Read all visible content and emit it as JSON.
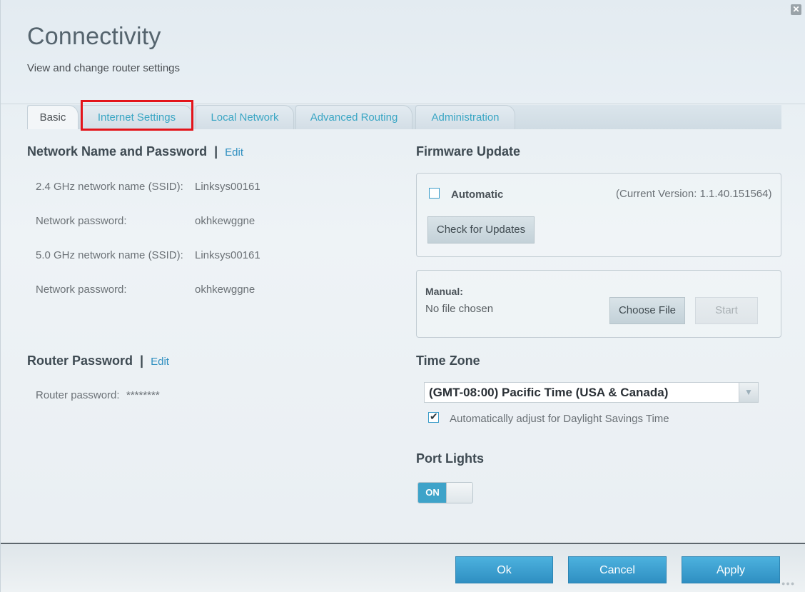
{
  "header": {
    "title": "Connectivity",
    "subtitle": "View and change router settings",
    "close_glyph": "✕"
  },
  "tabs": [
    {
      "label": "Basic",
      "active": true
    },
    {
      "label": "Internet Settings",
      "active": false
    },
    {
      "label": "Local Network",
      "active": false
    },
    {
      "label": "Advanced Routing",
      "active": false
    },
    {
      "label": "Administration",
      "active": false
    }
  ],
  "network": {
    "title": "Network Name and Password",
    "separator": "|",
    "edit_label": "Edit",
    "rows": [
      {
        "label": "2.4 GHz network name (SSID):",
        "value": "Linksys00161"
      },
      {
        "label": "Network password:",
        "value": "okhkewggne"
      },
      {
        "label": "5.0 GHz network name (SSID):",
        "value": "Linksys00161"
      },
      {
        "label": "Network password:",
        "value": "okhkewggne"
      }
    ]
  },
  "router_password": {
    "title": "Router Password",
    "separator": "|",
    "edit_label": "Edit",
    "label": "Router password:",
    "value": "********"
  },
  "firmware": {
    "title": "Firmware Update",
    "automatic_label": "Automatic",
    "automatic_checked": false,
    "current_version": "(Current Version: 1.1.40.151564)",
    "check_button": "Check for Updates",
    "manual_label": "Manual:",
    "file_status": "No file chosen",
    "choose_file_button": "Choose File",
    "start_button": "Start"
  },
  "time_zone": {
    "title": "Time Zone",
    "selected": "(GMT-08:00) Pacific Time (USA & Canada)",
    "dst_label": "Automatically adjust for Daylight Savings Time",
    "dst_checked": true
  },
  "port_lights": {
    "title": "Port Lights",
    "state_label": "ON"
  },
  "footer": {
    "ok": "Ok",
    "cancel": "Cancel",
    "apply": "Apply"
  },
  "watermark": "●●●",
  "colors": {
    "accent": "#3aa6c4",
    "link": "#2f8fc0",
    "primary_button": "#3a9fd0",
    "highlight": "#e3141a"
  }
}
